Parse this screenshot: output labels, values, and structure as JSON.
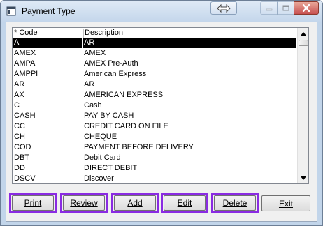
{
  "window": {
    "title": "Payment Type"
  },
  "list": {
    "columns": [
      "* Code",
      "Description"
    ],
    "rows": [
      {
        "code": "A",
        "description": "AR",
        "selected": true
      },
      {
        "code": "AMEX",
        "description": "AMEX"
      },
      {
        "code": "AMPA",
        "description": "AMEX Pre-Auth"
      },
      {
        "code": "AMPPI",
        "description": "American Express"
      },
      {
        "code": "AR",
        "description": "AR"
      },
      {
        "code": "AX",
        "description": "AMERICAN EXPRESS"
      },
      {
        "code": "C",
        "description": "Cash"
      },
      {
        "code": "CASH",
        "description": "PAY BY CASH"
      },
      {
        "code": "CC",
        "description": "CREDIT CARD ON FILE"
      },
      {
        "code": "CH",
        "description": "CHEQUE"
      },
      {
        "code": "COD",
        "description": "PAYMENT BEFORE DELIVERY"
      },
      {
        "code": "DBT",
        "description": "Debit Card"
      },
      {
        "code": "DD",
        "description": "DIRECT DEBIT"
      },
      {
        "code": "DSCV",
        "description": "Discover"
      }
    ]
  },
  "buttons": {
    "print": "Print",
    "review": "Review",
    "add": "Add",
    "edit": "Edit",
    "delete": "Delete",
    "exit": "Exit"
  },
  "icons": {
    "app": "window-icon",
    "restore": "double-arrow-icon",
    "minimize": "minimize-icon",
    "maximize": "maximize-icon",
    "close": "close-icon",
    "scroll_up": "scroll-up-arrow-icon",
    "scroll_down": "scroll-down-arrow-icon"
  },
  "colors": {
    "selection_bg": "#000000",
    "highlight_border": "#8a2be2",
    "close_button": "#c75050"
  }
}
